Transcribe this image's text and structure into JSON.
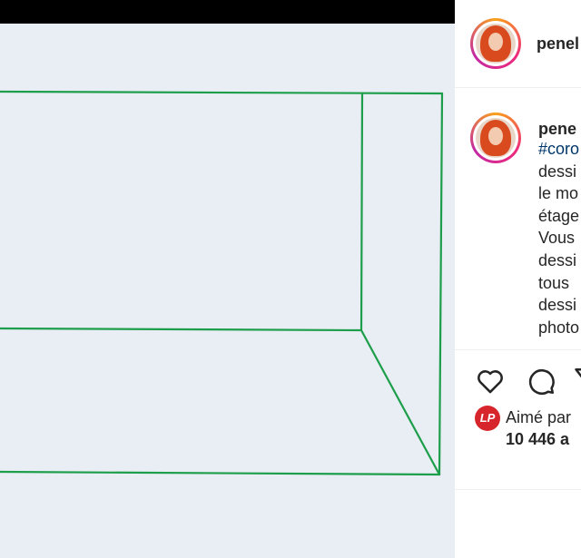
{
  "post": {
    "username": "penel",
    "caption_username": "pene",
    "hashtag": "#coro",
    "caption_lines": [
      "dessi",
      "le mo",
      "étage",
      "Vous",
      "dessi",
      "tous",
      "dessi",
      "photo"
    ]
  },
  "engagement": {
    "liked_by_label": "Aimé par",
    "liker_badge": "LP",
    "likes_count": "10 446 a"
  },
  "icons": [
    "heart-icon",
    "comment-icon",
    "share-icon"
  ],
  "colors": {
    "drawing_line": "#1d9e4a",
    "paper": "#e9edf4",
    "hashtag": "#00376b"
  }
}
